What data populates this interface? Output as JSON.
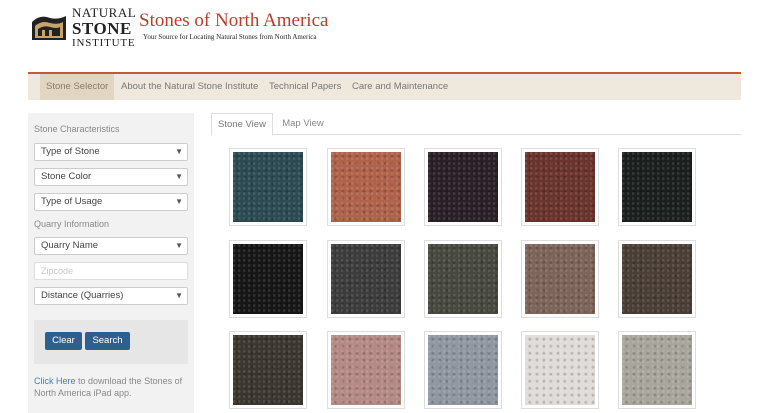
{
  "header": {
    "logo": {
      "line1": "NATURAL",
      "line2": "STONE",
      "line3": "INSTITUTE"
    },
    "title": "Stones of North America",
    "tagline": "Your Source for Locating Natural Stones from North America"
  },
  "nav": {
    "items": [
      {
        "label": "Stone Selector",
        "active": true
      },
      {
        "label": "About the Natural Stone Institute"
      },
      {
        "label": "Technical Papers"
      },
      {
        "label": "Care and Maintenance"
      }
    ]
  },
  "sidebar": {
    "characteristics_label": "Stone Characteristics",
    "type_of_stone": "Type of Stone",
    "stone_color": "Stone Color",
    "type_of_usage": "Type of Usage",
    "quarry_label": "Quarry Information",
    "quarry_name": "Quarry Name",
    "zipcode_placeholder": "Zipcode",
    "distance": "Distance (Quarries)",
    "caret": "▼",
    "clear_label": "Clear",
    "search_label": "Search",
    "note_link": "Click Here",
    "note_text": " to download the Stones of North America iPad app."
  },
  "tabs": [
    {
      "label": "Stone View",
      "active": true
    },
    {
      "label": "Map View"
    }
  ],
  "stones": [
    {
      "color": "#2c4a52"
    },
    {
      "color": "#b0624a"
    },
    {
      "color": "#2a1f26"
    },
    {
      "color": "#6a342c"
    },
    {
      "color": "#1b1f1d"
    },
    {
      "color": "#161616"
    },
    {
      "color": "#3c3c3c"
    },
    {
      "color": "#474840"
    },
    {
      "color": "#7d6458"
    },
    {
      "color": "#4a3e36"
    },
    {
      "color": "#3c3630"
    },
    {
      "color": "#b58a84"
    },
    {
      "color": "#9097a0"
    },
    {
      "color": "#e0dcd8"
    },
    {
      "color": "#a8a69c"
    }
  ]
}
